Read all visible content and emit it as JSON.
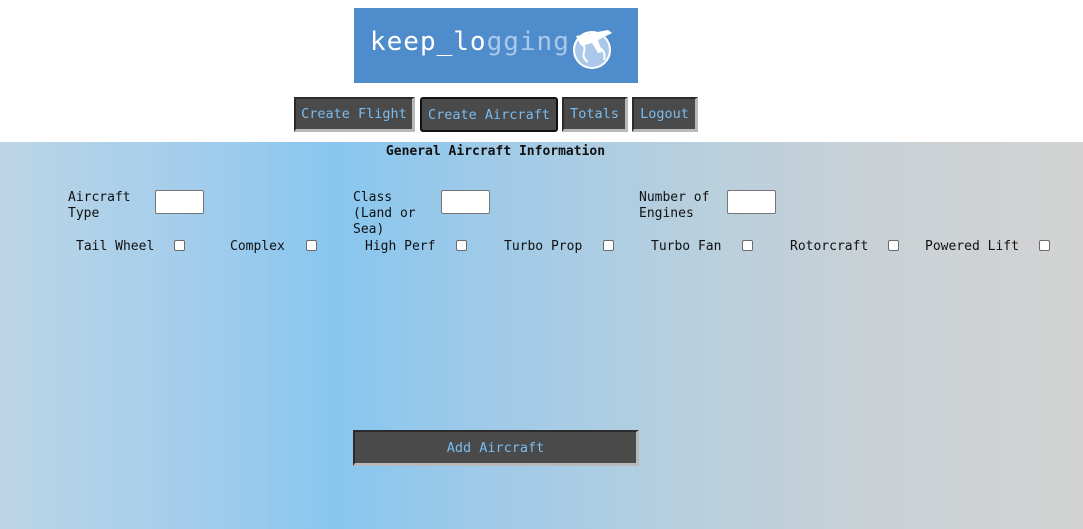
{
  "logo": {
    "text_main": "keep_lo",
    "text_fade": "gging",
    "icon": "globe-airplane-icon",
    "bg_color": "#4f8ccc"
  },
  "nav": {
    "create_flight": "Create Flight",
    "create_aircraft": "Create Aircraft",
    "totals": "Totals",
    "logout": "Logout"
  },
  "form": {
    "section_title": "General Aircraft Information",
    "aircraft_type_label": "Aircraft Type",
    "aircraft_type_value": "",
    "class_label": "Class (Land or Sea)",
    "class_value": "",
    "engines_label": "Number of Engines",
    "engines_value": "",
    "checkboxes": [
      {
        "label": "Tail Wheel",
        "checked": false
      },
      {
        "label": "Complex",
        "checked": false
      },
      {
        "label": "High Perf",
        "checked": false
      },
      {
        "label": "Turbo Prop",
        "checked": false
      },
      {
        "label": "Turbo Fan",
        "checked": false
      },
      {
        "label": "Rotorcraft",
        "checked": false
      },
      {
        "label": "Powered Lift",
        "checked": false
      }
    ],
    "submit_label": "Add Aircraft"
  },
  "colors": {
    "button_bg": "#4a4a4a",
    "button_text": "#79bcf0",
    "gradient_accent": "#88c6ef"
  }
}
